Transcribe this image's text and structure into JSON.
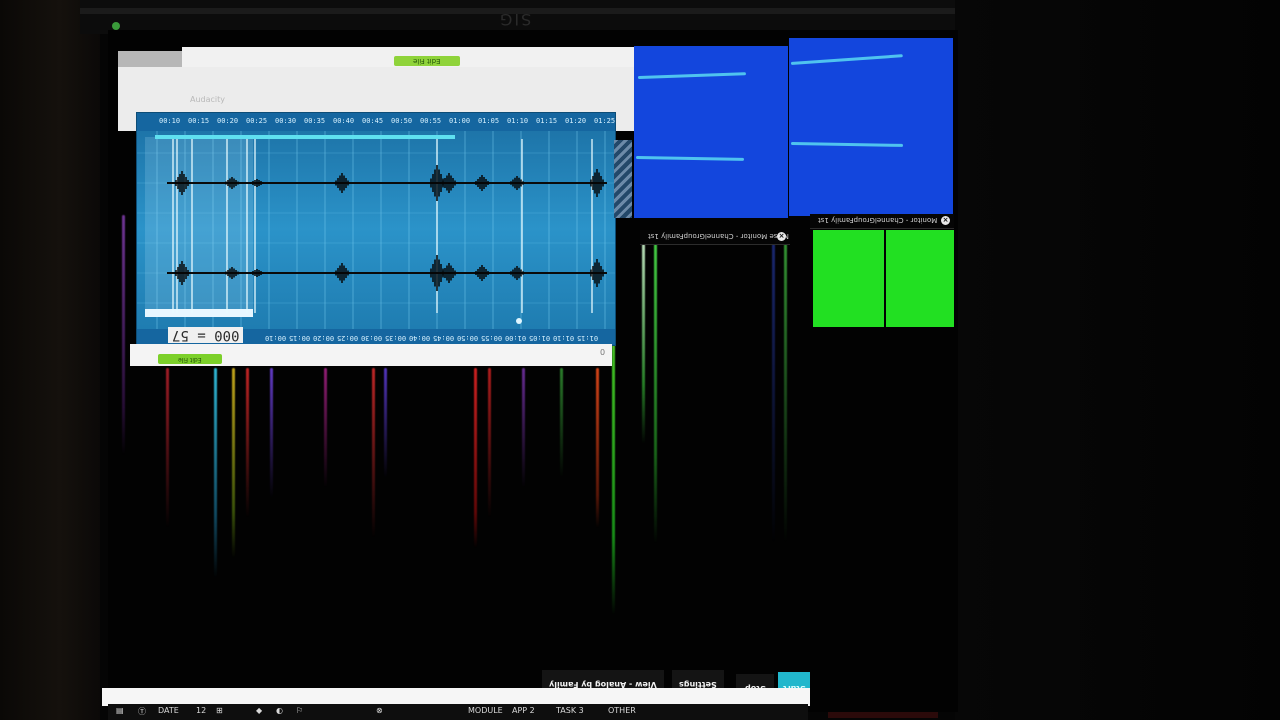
{
  "topbar": {
    "title": "SIG"
  },
  "media_window": {
    "title_faint": "Audacity",
    "status_pill_top": "Edit File",
    "status_pill_bottom": "Edit File",
    "counter": "000 = 57",
    "transport": {
      "prev": "◀◀",
      "play": "▶",
      "record": "●",
      "next": "▶▶"
    },
    "timeline_labels": [
      "00:10",
      "00:15",
      "00:20",
      "00:25",
      "00:30",
      "00:35",
      "00:40",
      "00:45",
      "00:50",
      "00:55",
      "01:00",
      "01:05",
      "01:10",
      "01:15",
      "01:20",
      "01:25"
    ],
    "bottom_labels": [
      "00:10",
      "00:15",
      "00:20",
      "00:25",
      "00:30",
      "00:35",
      "00:40",
      "00:45",
      "00:50",
      "00:55",
      "01:00",
      "01:05",
      "01:10",
      "01:15"
    ],
    "bottom_right": "0"
  },
  "monitors": {
    "left": {
      "title": "Noise Monitor - ChannelGroupFamily 1st",
      "close": "×"
    },
    "right": {
      "title": "Monitor - ChannelGroupFamily 1st",
      "close": "×"
    }
  },
  "controls": {
    "start": "Start",
    "stop": "Stop",
    "settings": "Settings",
    "view_mode": "View - Analog by Family"
  },
  "taskbar": {
    "items": [
      "▤",
      "Ⓣ",
      "DATE",
      "12",
      "⊞",
      "◆",
      "◐",
      "⚐",
      "⊗",
      "MODULE",
      "APP 2",
      "TASK 3",
      "OTHER"
    ]
  },
  "colors": {
    "wave_bg": "#2b93c9",
    "tile_blue": "#1346dd",
    "tile_green": "#22e022",
    "accent": "#21b7cc"
  }
}
